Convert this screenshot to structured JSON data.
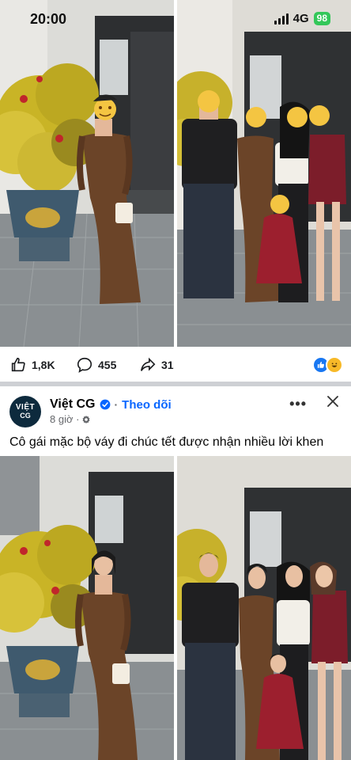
{
  "status_bar": {
    "time": "20:00",
    "network": "4G",
    "battery": "98"
  },
  "post_top": {
    "likes": "1,8K",
    "comments": "455",
    "shares": "31"
  },
  "post": {
    "page_name": "Việt CG",
    "avatar_text_top": "VIỆT",
    "avatar_text_bottom": "CG",
    "follow_label": "Theo dõi",
    "time_ago": "8 giờ ·",
    "caption": "Cô gái mặc bộ váy đi chúc tết được nhận nhiều lời khen"
  },
  "icons": {
    "like": "thumbs-up-icon",
    "comment": "comment-bubble-icon",
    "share": "share-arrow-icon",
    "reactions": [
      "like-reaction-icon",
      "haha-reaction-icon"
    ],
    "verified": "verified-badge-icon",
    "audience": "globe-settings-icon",
    "more": "more-dots-icon",
    "close": "close-icon"
  },
  "colors": {
    "link_blue": "#0866ff",
    "divider": "#ced0d4",
    "secondary_text": "#65676b",
    "battery_green": "#33c759",
    "dress_brown": "#6b4428",
    "dress_red": "#9c1f2e"
  }
}
